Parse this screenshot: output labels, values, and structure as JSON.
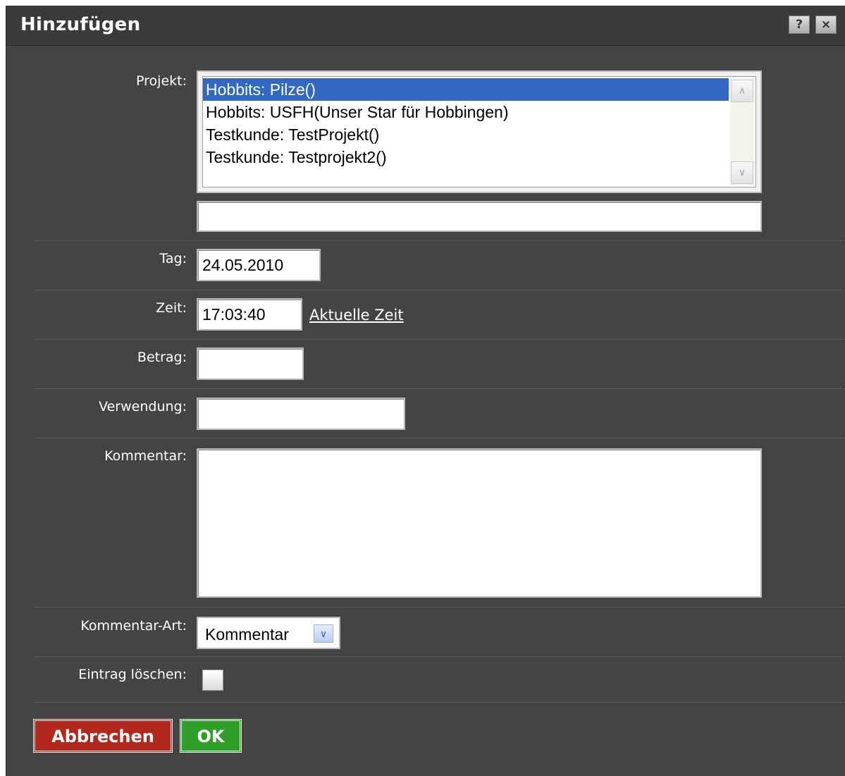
{
  "dialog": {
    "title": "Hinzufügen",
    "help_label": "?",
    "close_label": "×"
  },
  "form": {
    "projekt_label": "Projekt:",
    "projekt_options": [
      "Hobbits: Pilze()",
      "Hobbits: USFH(Unser Star für Hobbingen)",
      "Testkunde: TestProjekt()",
      "Testkunde: Testprojekt2()"
    ],
    "projekt_selected_index": 0,
    "projekt_filter_value": "",
    "tag_label": "Tag:",
    "tag_value": "24.05.2010",
    "zeit_label": "Zeit:",
    "zeit_value": "17:03:40",
    "zeit_link": "Aktuelle Zeit",
    "betrag_label": "Betrag:",
    "betrag_value": "",
    "verwendung_label": "Verwendung:",
    "verwendung_value": "",
    "kommentar_label": "Kommentar:",
    "kommentar_value": "",
    "kommentar_art_label": "Kommentar-Art:",
    "kommentar_art_value": "Kommentar",
    "loeschen_label": "Eintrag löschen:",
    "loeschen_checked": false
  },
  "buttons": {
    "cancel": "Abbrechen",
    "ok": "OK"
  },
  "colors": {
    "background": "#444444",
    "selection": "#3168c4",
    "cancel": "#b2281c",
    "ok": "#2ea02a"
  }
}
